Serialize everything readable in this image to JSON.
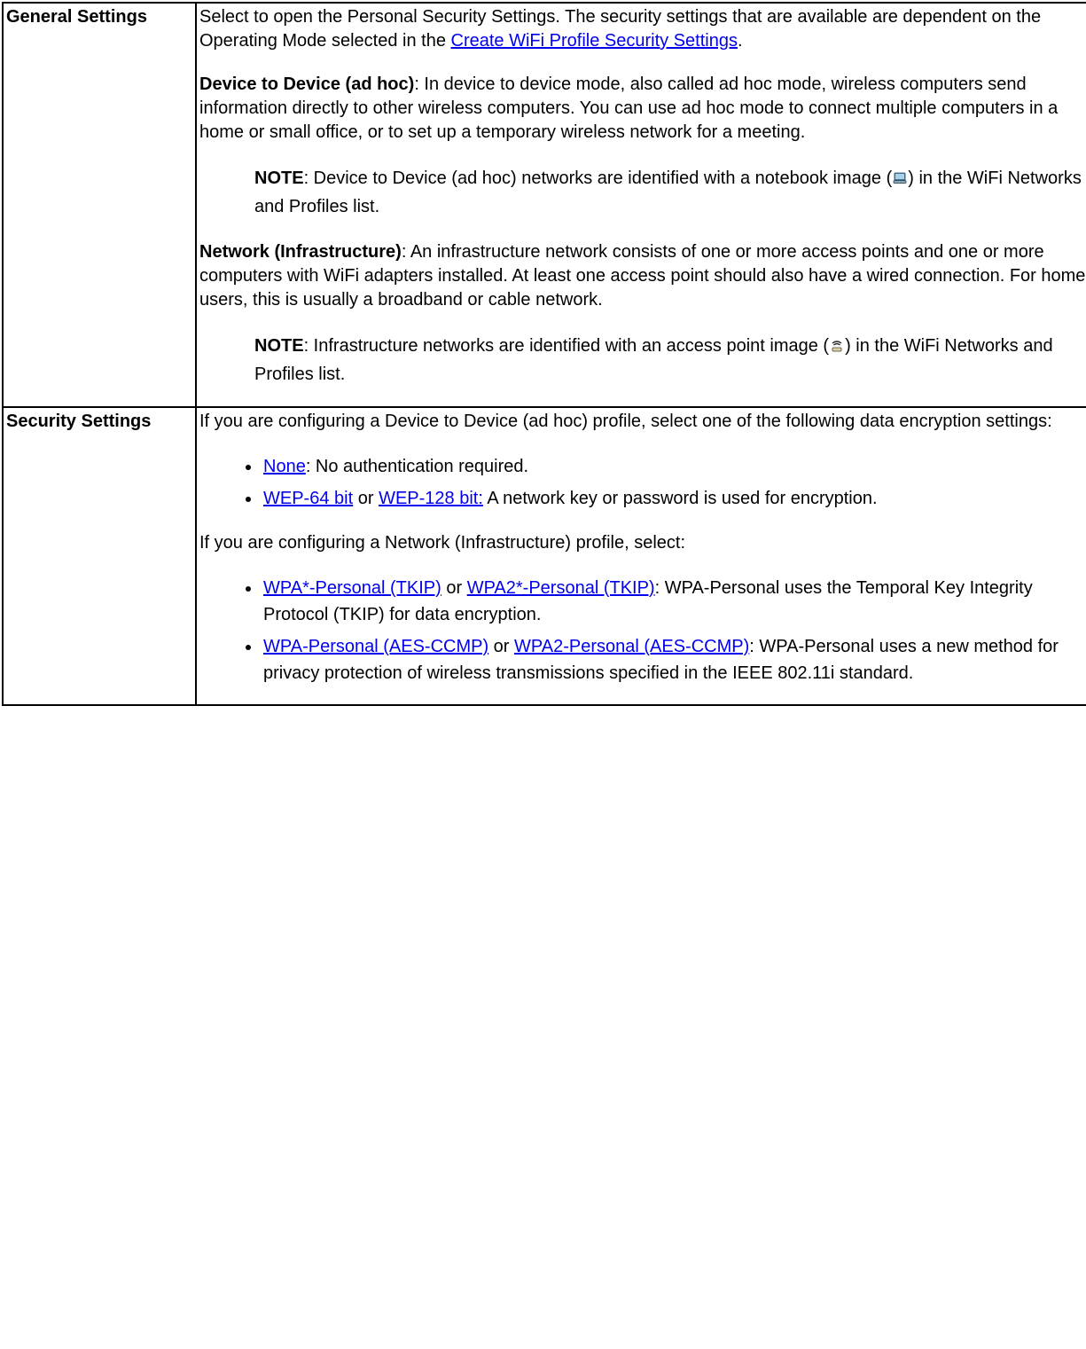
{
  "rows": {
    "general": {
      "label": "General Settings",
      "intro_pre": "Select to open the Personal Security Settings. The security settings that are available are dependent on the Operating Mode selected in the ",
      "intro_link": "Create WiFi Profile Security Settings",
      "intro_post": ".",
      "adhoc_term": "Device to Device (ad hoc)",
      "adhoc_text": ": In device to device mode, also called ad hoc mode, wireless computers send information directly to other wireless computers. You can use ad hoc mode to connect multiple computers in a home or small office, or to set up a temporary wireless network for a meeting.",
      "note_label": "NOTE",
      "adhoc_note_pre": ": Device to Device (ad hoc) networks are identified with a notebook image (",
      "adhoc_note_post": ") in the WiFi Networks and Profiles list.",
      "infra_term": "Network (Infrastructure)",
      "infra_text": ": An infrastructure network consists of one or more access points and one or more computers with WiFi adapters installed. At least one access point should also have a wired connection. For home users, this is usually a broadband or cable network.",
      "infra_note_pre": ": Infrastructure networks are identified with an access point image (",
      "infra_note_post": ") in the WiFi Networks and Profiles list."
    },
    "security": {
      "label": "Security Settings",
      "adhoc_intro": "If you are configuring a Device to Device (ad hoc) profile, select one of the following data encryption settings:",
      "opt_none": "None",
      "opt_none_desc": ": No authentication required.",
      "opt_wep64": "WEP-64 bit",
      "opt_or": " or ",
      "opt_wep128": "WEP-128 bit:",
      "opt_wep_desc": " A network key or password is used for encryption.",
      "infra_intro": "If you are configuring a Network (Infrastructure) profile, select:",
      "opt_wpa_tkip": "WPA*-Personal (TKIP)",
      "opt_wpa2_tkip": "WPA2*-Personal (TKIP)",
      "opt_tkip_desc": ": WPA-Personal uses the Temporal Key Integrity Protocol (TKIP) for data encryption.",
      "opt_wpa_aes": "WPA-Personal (AES-CCMP)",
      "opt_wpa2_aes": "WPA2-Personal (AES-CCMP)",
      "opt_aes_desc": ": WPA-Personal uses a new method for privacy protection of wireless transmissions specified in the IEEE 802.11i standard."
    }
  }
}
